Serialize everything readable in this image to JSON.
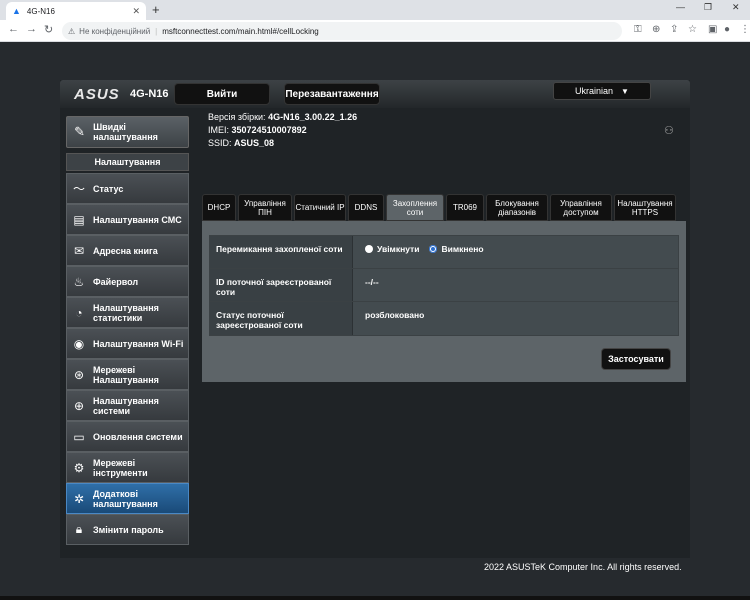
{
  "browser": {
    "tab_title": "4G-N16",
    "tab_close": "✕",
    "new_tab": "+",
    "not_secure": "Не конфіденційний",
    "url": "msftconnecttest.com/main.html#/cellLocking"
  },
  "header": {
    "logo": "ASUS",
    "model": "4G-N16",
    "logout_label": "Вийти",
    "reboot_label": "Перезавантаження",
    "language": "Ukrainian"
  },
  "info": {
    "firmware_label": "Версія збірки:",
    "firmware_value": "4G-N16_3.00.22_1.26",
    "imei_label": "IMEI:",
    "imei_value": "350724510007892",
    "ssid_label": "SSID:",
    "ssid_value": "ASUS_08"
  },
  "quick_setup": "Швидкі налаштування",
  "menu_header": "Налаштування",
  "menu": [
    {
      "label": "Статус",
      "icon": "pulse-icon"
    },
    {
      "label": "Налаштування СМС",
      "icon": "sms-icon"
    },
    {
      "label": "Адресна книга",
      "icon": "address-book-icon"
    },
    {
      "label": "Файервол",
      "icon": "firewall-icon"
    },
    {
      "label": "Налаштування статистики",
      "icon": "gauge-icon"
    },
    {
      "label": "Налаштування Wi-Fi",
      "icon": "wifi-icon"
    },
    {
      "label": "Мережеві Налаштування",
      "icon": "network-icon"
    },
    {
      "label": "Налаштування системи",
      "icon": "globe-icon"
    },
    {
      "label": "Оновлення системи",
      "icon": "monitor-icon"
    },
    {
      "label": "Мережеві інструменти",
      "icon": "tools-icon"
    },
    {
      "label": "Додаткові налаштування",
      "icon": "advanced-icon"
    },
    {
      "label": "Змінити пароль",
      "icon": "lock-icon"
    }
  ],
  "tabs": [
    {
      "label": "DHCP"
    },
    {
      "label": "Управління ПІН"
    },
    {
      "label": "Статичний IP"
    },
    {
      "label": "DDNS"
    },
    {
      "label": "Захоплення соти"
    },
    {
      "label": "TR069"
    },
    {
      "label": "Блокування діапазонів"
    },
    {
      "label": "Управління доступом"
    },
    {
      "label": "Налаштування HTTPS"
    }
  ],
  "form": {
    "switch_label": "Перемикання захопленої соти",
    "on_label": "Увімкнути",
    "off_label": "Вимкнено",
    "cell_id_label": "ID поточної зареєстрованої соти",
    "cell_id_value": "--/--",
    "status_label": "Статус поточної зареєстрованої соти",
    "status_value": "розблоковано",
    "apply_label": "Застосувати"
  },
  "copyright": "2022 ASUSTeK Computer Inc. All rights reserved."
}
